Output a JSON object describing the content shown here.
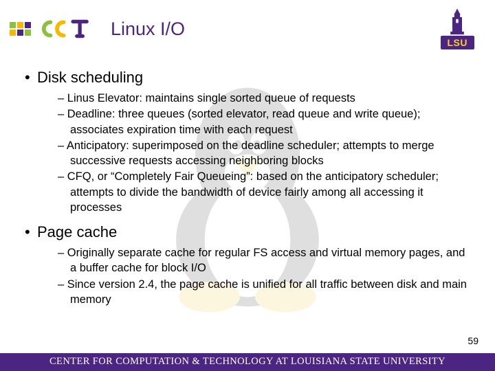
{
  "header": {
    "title": "Linux I/O",
    "lsu_label": "LSU"
  },
  "sections": [
    {
      "heading": "Disk scheduling",
      "items": [
        "Linus Elevator: maintains single sorted queue of requests",
        "Deadline: three queues (sorted elevator, read queue and write queue); associates expiration time with each request",
        "Anticipatory: superimposed on the deadline scheduler; attempts to merge successive requests accessing neighboring blocks",
        "CFQ, or “Completely Fair Queueing”: based on the anticipatory scheduler; attempts to divide the bandwidth of device fairly among all accessing it processes"
      ]
    },
    {
      "heading": "Page cache",
      "items": [
        "Originally separate cache for regular FS access and virtual memory pages, and a buffer cache for block I/O",
        "Since version 2.4, the page cache is unified for all traffic between disk and main memory"
      ]
    }
  ],
  "page_number": "59",
  "footer": "CENTER FOR COMPUTATION & TECHNOLOGY AT LOUISIANA STATE UNIVERSITY"
}
